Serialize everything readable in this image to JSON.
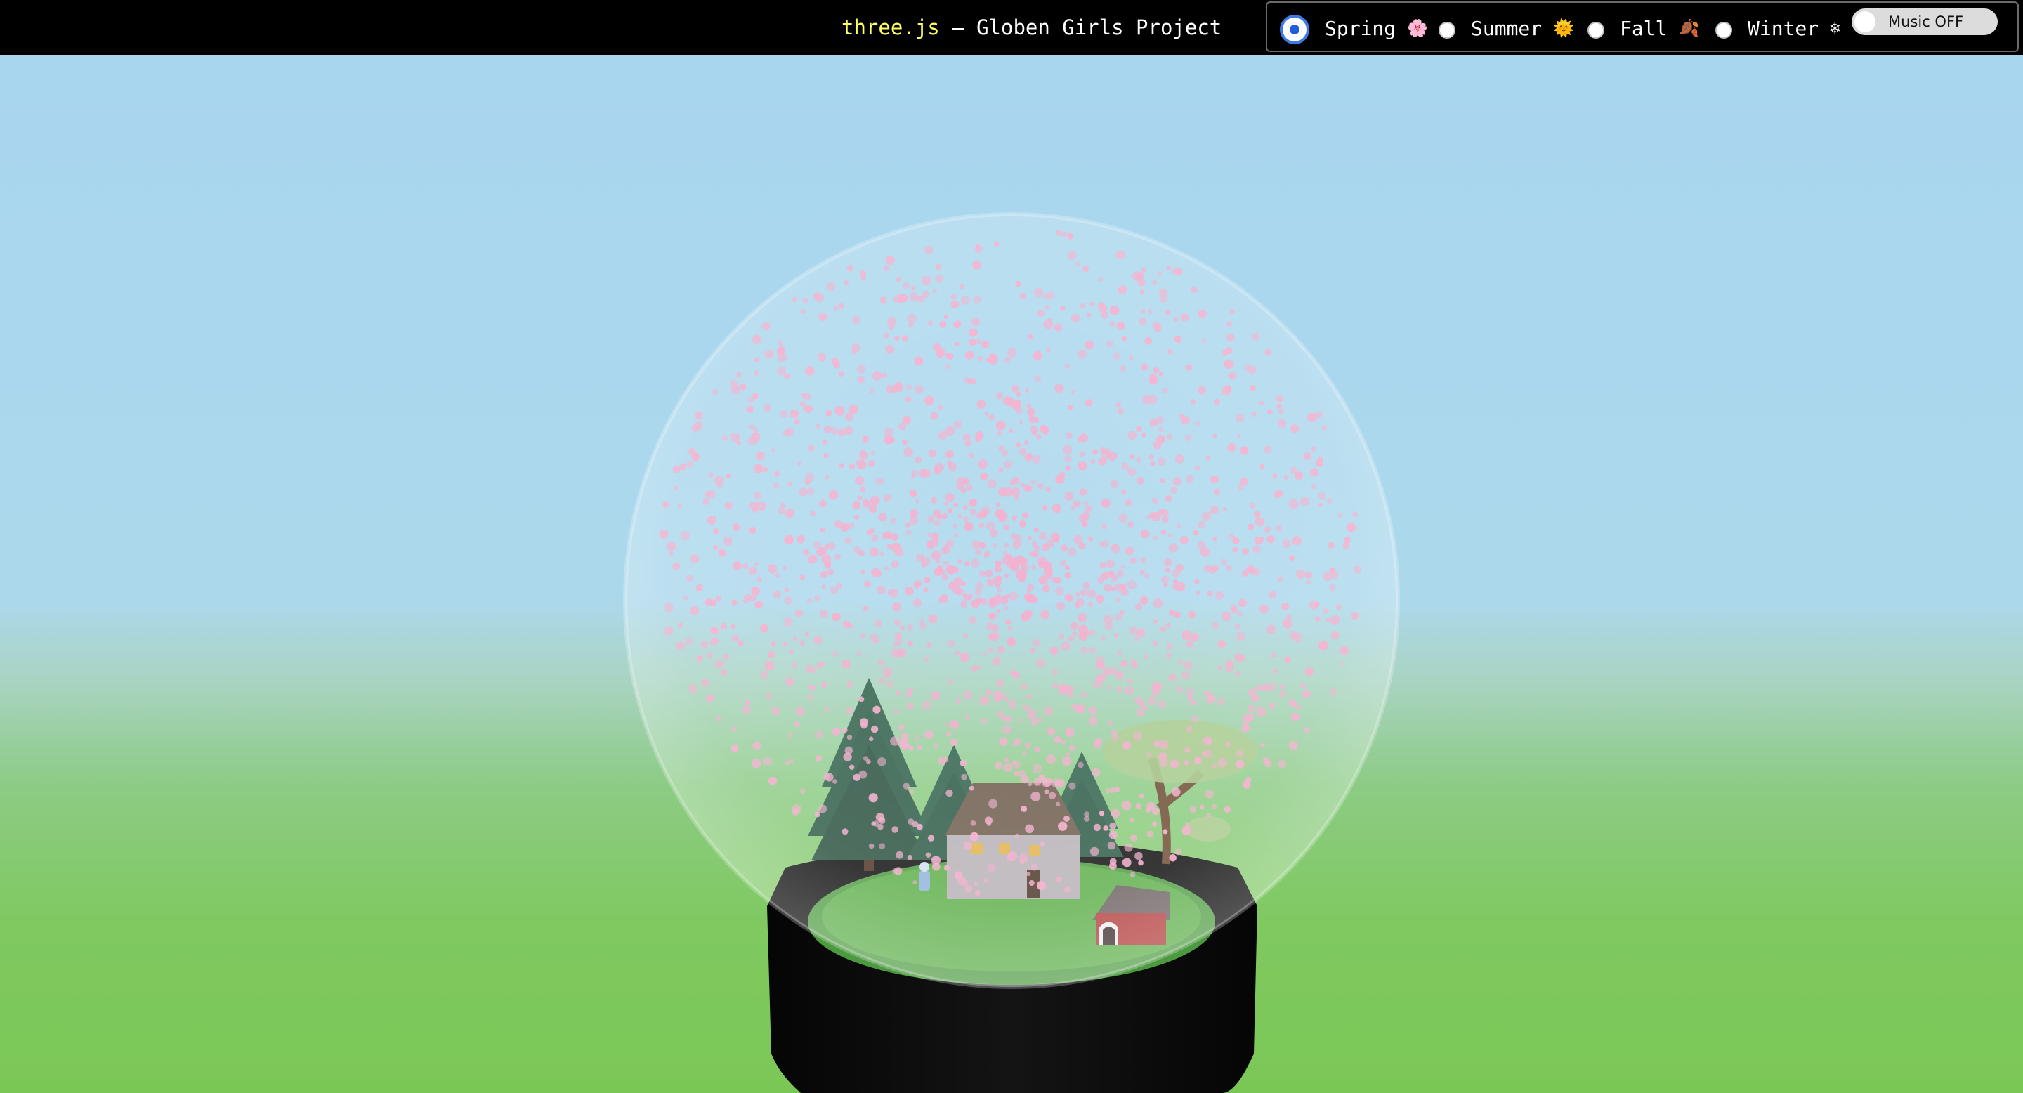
{
  "header": {
    "title_brand": "three.js",
    "title_rest": " – Globen Girls Project"
  },
  "seasons": {
    "selected": "Spring",
    "options": [
      {
        "label": "Spring",
        "emoji": "🌸",
        "icon": "cherry-blossom-icon"
      },
      {
        "label": "Summer",
        "emoji": "🌞",
        "icon": "sun-icon"
      },
      {
        "label": "Fall",
        "emoji": "🍂",
        "icon": "fallen-leaf-icon"
      },
      {
        "label": "Winter",
        "emoji": "❄",
        "icon": "snowflake-icon"
      }
    ]
  },
  "music": {
    "label": "Music OFF",
    "on": false
  },
  "colors": {
    "header_bg": "#000000",
    "brand_text": "#ffff66",
    "sky": "#acd8ec",
    "grass": "#7bc756",
    "petal": "#f3a6c8",
    "globe_base": "#0a0a0a"
  }
}
